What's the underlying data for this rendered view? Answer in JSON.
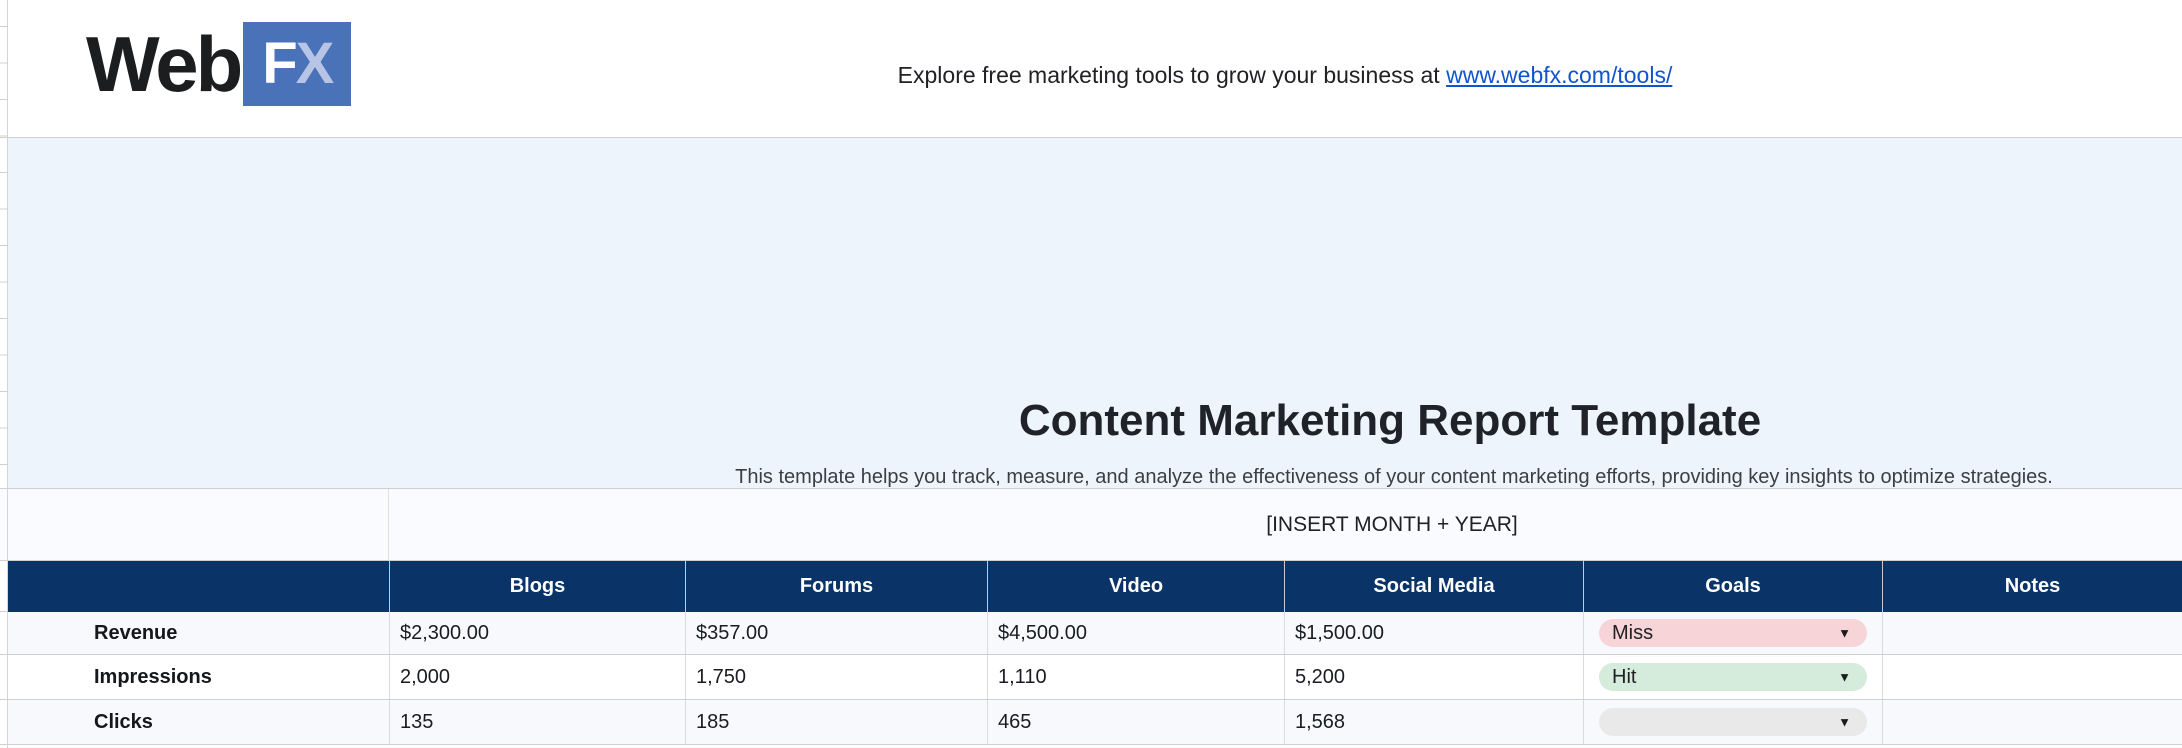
{
  "header": {
    "logo": {
      "text_black": "Web",
      "fx_f": "F",
      "fx_x": "X"
    },
    "tagline": {
      "prefix": "Explore free marketing tools to grow your business at ",
      "link": "www.webfx.com/tools/"
    }
  },
  "hero": {
    "title": "Content Marketing Report Template",
    "subtitle": "This template helps you track, measure, and analyze the effectiveness of your content marketing efforts, providing key insights to optimize strategies."
  },
  "period": {
    "label": "[INSERT MONTH + YEAR]"
  },
  "report_table": {
    "columns": [
      "",
      "Blogs",
      "Forums",
      "Video",
      "Social Media",
      "Goals",
      "Notes"
    ],
    "rows": [
      {
        "label": "Revenue",
        "values": [
          "$2,300.00",
          "$357.00",
          "$4,500.00",
          "$1,500.00"
        ],
        "goal": "Miss",
        "goal_state": "miss",
        "notes": ""
      },
      {
        "label": "Impressions",
        "values": [
          "2,000",
          "1,750",
          "1,110",
          "5,200"
        ],
        "goal": "Hit",
        "goal_state": "hit",
        "notes": ""
      },
      {
        "label": "Clicks",
        "values": [
          "135",
          "185",
          "465",
          "1,568"
        ],
        "goal": "",
        "goal_state": "empty",
        "notes": ""
      }
    ]
  },
  "icons": {
    "dropdown": "▼"
  },
  "colors": {
    "navy_header": "#0a3367",
    "panel_blue": "#edf4fc",
    "logo_box_blue": "#4a72b8",
    "logo_x_blue": "#b7c4e6",
    "link_blue": "#1155cc",
    "goal_miss_bg": "#f7d4d8",
    "goal_hit_bg": "#d5ebdc",
    "goal_empty_bg": "#e9e9e9",
    "banded_row_bg": "#f7f9fc"
  }
}
